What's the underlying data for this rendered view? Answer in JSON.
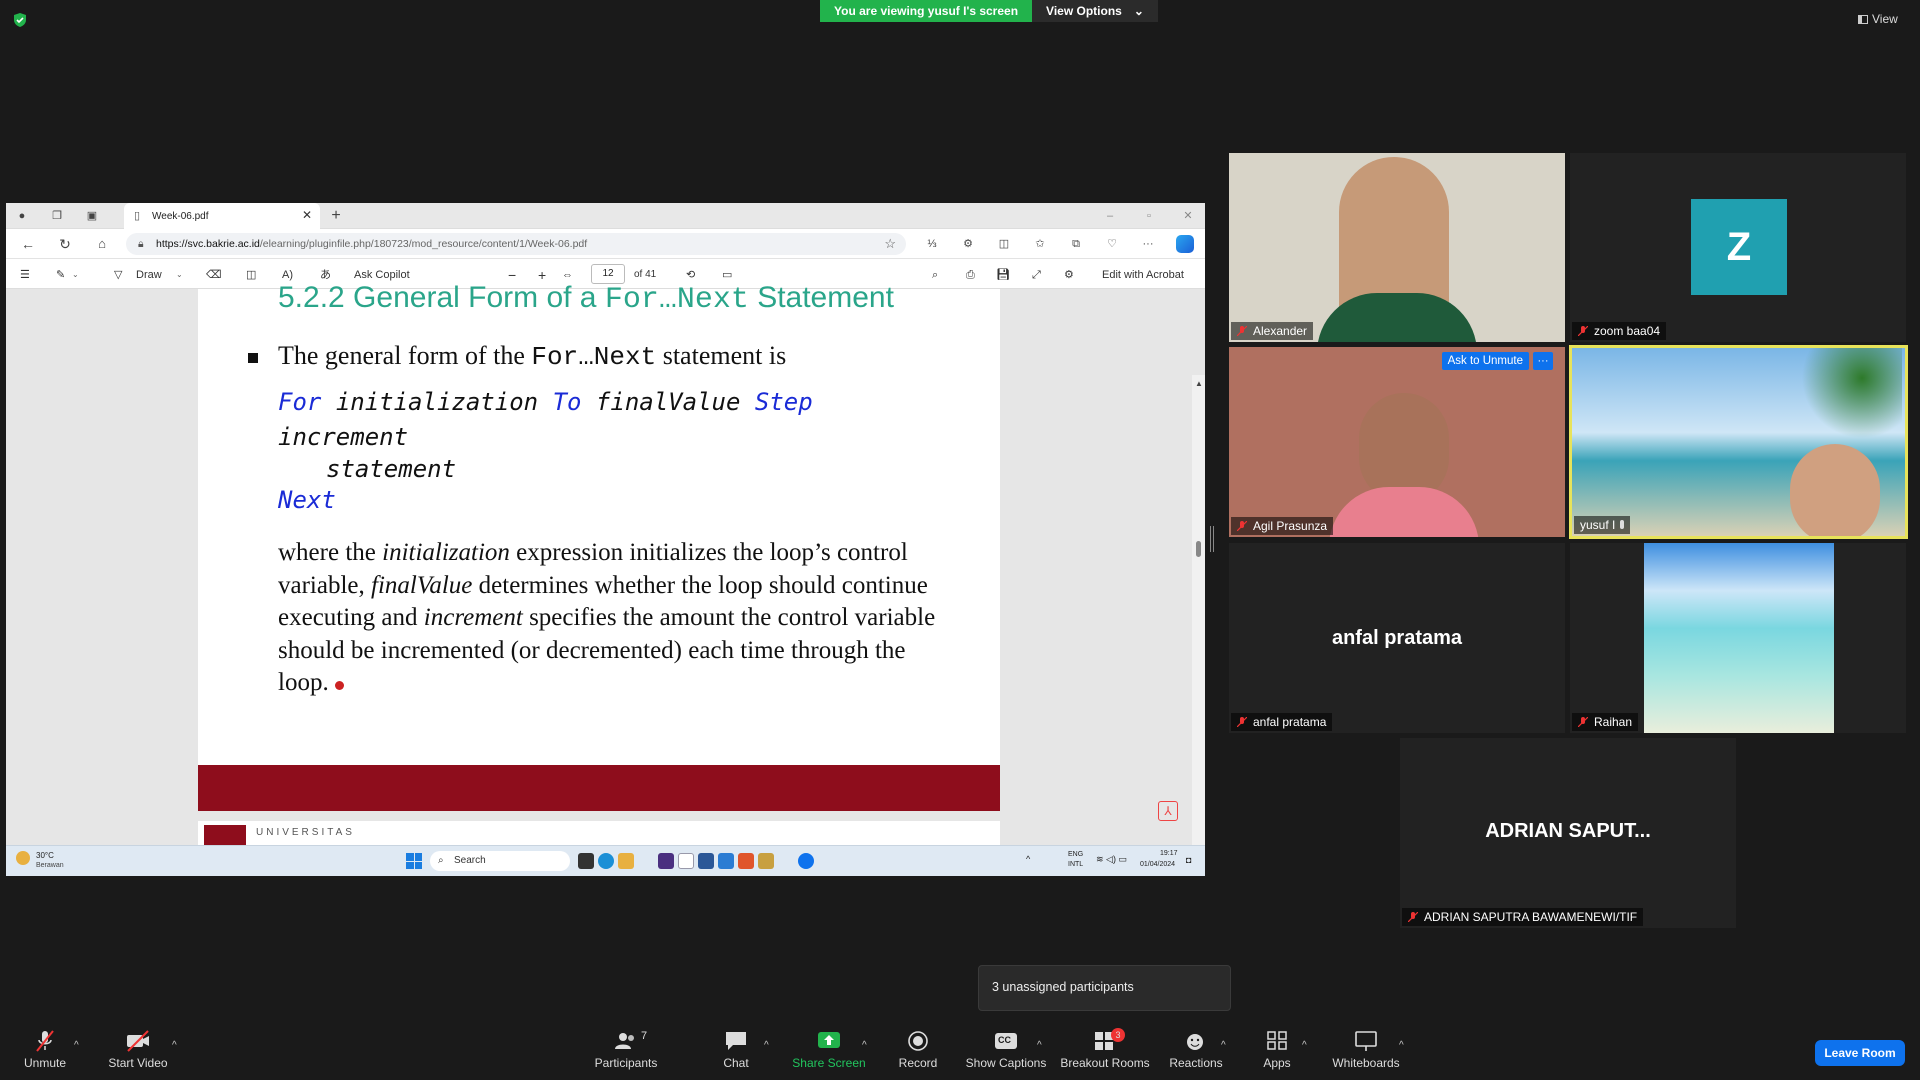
{
  "banner": {
    "viewing": "You are viewing yusuf I's screen",
    "options": "View Options"
  },
  "top_right": {
    "view_label": "View"
  },
  "browser": {
    "tab_title": "Week-06.pdf",
    "url_host": "https://svc.bakrie.ac.id",
    "url_path": "/elearning/pluginfile.php/180723/mod_resource/content/1/Week-06.pdf",
    "draw_label": "Draw",
    "ask_copilot": "Ask Copilot",
    "page_current": "12",
    "page_total": "of 41",
    "edit_acrobat": "Edit with Acrobat"
  },
  "slide": {
    "title_pre": "5.2.2 General Form of a ",
    "title_code": "For…Next",
    "title_post": " Statement",
    "bullet_pre": "The general form of the ",
    "bullet_code": "For…Next",
    "bullet_post": " statement is",
    "code": {
      "for": "For",
      "initialization": "initialization",
      "to": "To",
      "final_value": "finalValue",
      "step": "Step",
      "increment": "increment",
      "statement": "statement",
      "next": "Next"
    },
    "para": {
      "p1": "where the ",
      "i1": "initialization",
      "p2": " expression initializes the loop’s control variable, ",
      "i2": "finalValue",
      "p3": " determines whether the loop should continue executing and ",
      "i3": "increment",
      "p4": " specifies the amount the control variable should be incremented (or decremented) each time through the loop."
    },
    "next_slide_text": "UNIVERSITAS"
  },
  "taskbar": {
    "weather_temp": "30°C",
    "weather_desc": "Berawan",
    "search": "Search",
    "lang1": "ENG",
    "lang2": "INTL",
    "time": "19:17",
    "date": "01/04/2024"
  },
  "participants": [
    {
      "name": "Alexander"
    },
    {
      "name": "zoom baa04",
      "initial": "Z"
    },
    {
      "name": "Agil Prasunza",
      "ask_unmute": "Ask to Unmute",
      "more": "···"
    },
    {
      "name": "yusuf I"
    },
    {
      "name": "anfal pratama",
      "big": "anfal pratama"
    },
    {
      "name": "Raihan"
    },
    {
      "name": "ADRIAN SAPUTRA BAWAMENEWI/TIF",
      "big": "ADRIAN  SAPUT..."
    }
  ],
  "tooltip": "3 unassigned participants",
  "toolbar": {
    "unmute": "Unmute",
    "start_video": "Start Video",
    "participants": "Participants",
    "participants_count": "7",
    "chat": "Chat",
    "share_screen": "Share Screen",
    "record": "Record",
    "captions": "Show Captions",
    "breakout": "Breakout Rooms",
    "breakout_badge": "3",
    "reactions": "Reactions",
    "apps": "Apps",
    "whiteboards": "Whiteboards",
    "leave": "Leave Room",
    "cc": "CC"
  },
  "colors": {
    "zoom_blue": "#0e72ed",
    "share_green": "#22b34c",
    "active_speaker": "#e8e35a",
    "slide_accent": "#2aa58a",
    "slide_band": "#8e0d1c",
    "keyword_blue": "#1a2bd6"
  }
}
